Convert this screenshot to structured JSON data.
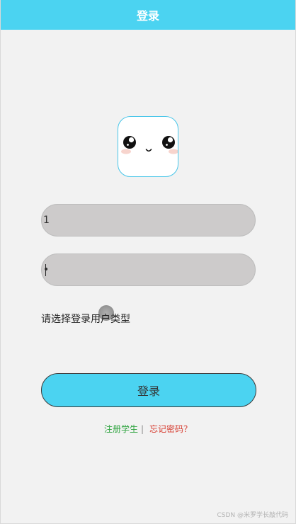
{
  "header": {
    "title": "登录"
  },
  "form": {
    "username_value": "1",
    "password_value": "•",
    "user_type_label": "请选择登录用户类型"
  },
  "actions": {
    "login_label": "登录",
    "register_label": "注册学生",
    "divider": "|",
    "forgot_label": "忘记密码？"
  },
  "watermark": "CSDN @米罗学长敲代码",
  "colors": {
    "accent": "#4bd3f1",
    "background": "#f2f2f2",
    "input_fill": "#cdcbcb",
    "register_link": "#2ea43f",
    "forgot_link": "#d63b2f"
  },
  "icons": {
    "avatar": "cute-face-icon"
  }
}
